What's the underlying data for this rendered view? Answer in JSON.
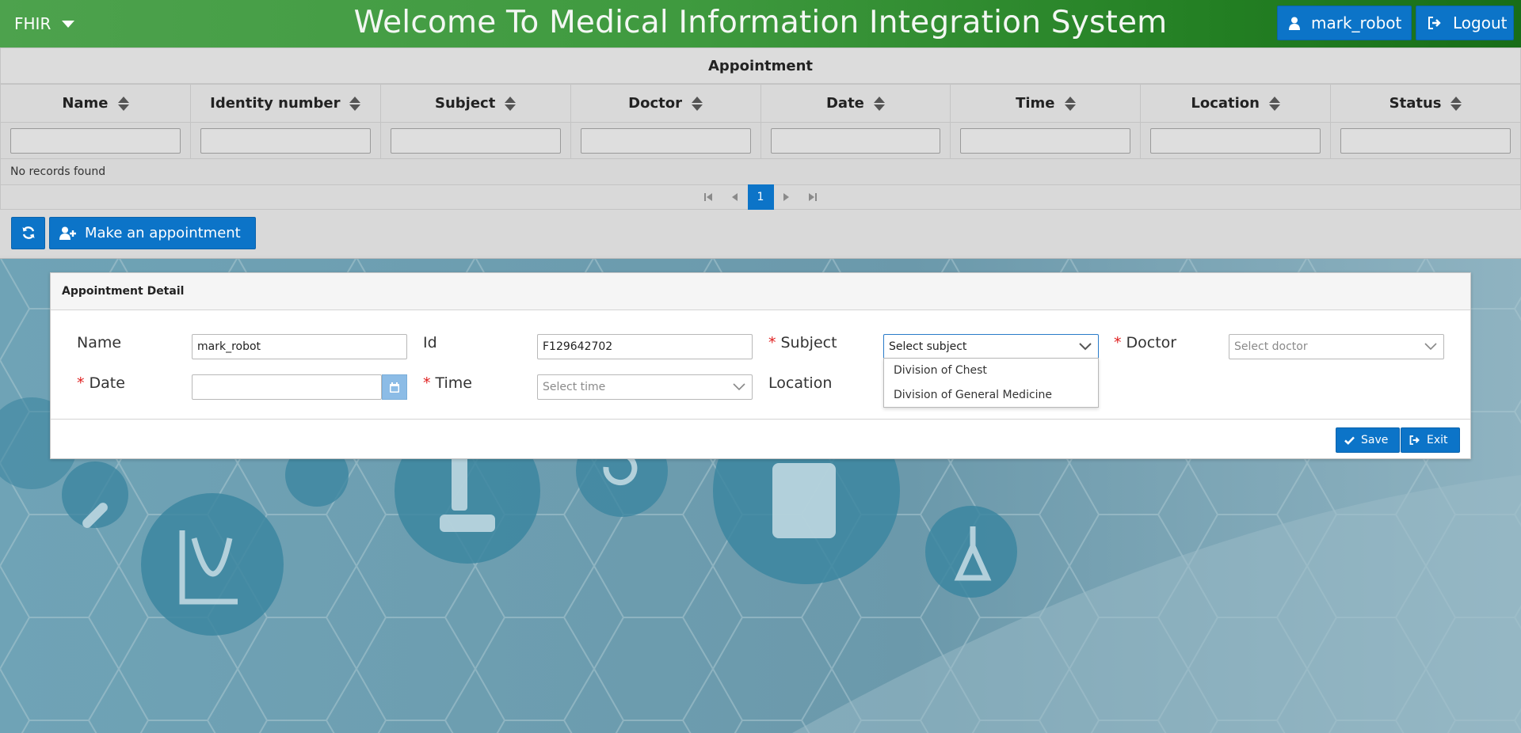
{
  "header": {
    "brand": "FHIR",
    "title": "Welcome To Medical Information Integration System",
    "user_label": "mark_robot",
    "logout_label": "Logout"
  },
  "table": {
    "caption": "Appointment",
    "columns": [
      "Name",
      "Identity number",
      "Subject",
      "Doctor",
      "Date",
      "Time",
      "Location",
      "Status"
    ],
    "empty_message": "No records found",
    "current_page": "1"
  },
  "actions": {
    "make_appointment_label": "Make an appointment"
  },
  "dialog": {
    "title": "Appointment Detail",
    "required_mark": "*",
    "name_label": "Name",
    "name_value": "mark_robot",
    "id_label": "Id",
    "id_value": "F129642702",
    "subject_label": "Subject",
    "subject_placeholder": "Select subject",
    "subject_options": [
      "Division of Chest",
      "Division of General Medicine"
    ],
    "doctor_label": "Doctor",
    "doctor_placeholder": "Select doctor",
    "date_label": "Date",
    "date_value": "",
    "time_label": "Time",
    "time_placeholder": "Select time",
    "location_label": "Location",
    "save_label": "Save",
    "exit_label": "Exit"
  },
  "colors": {
    "header_green": "#3f9a3f",
    "primary_blue": "#0c74c8",
    "required_red": "#e02020",
    "background_teal": "#6f9fb2"
  }
}
